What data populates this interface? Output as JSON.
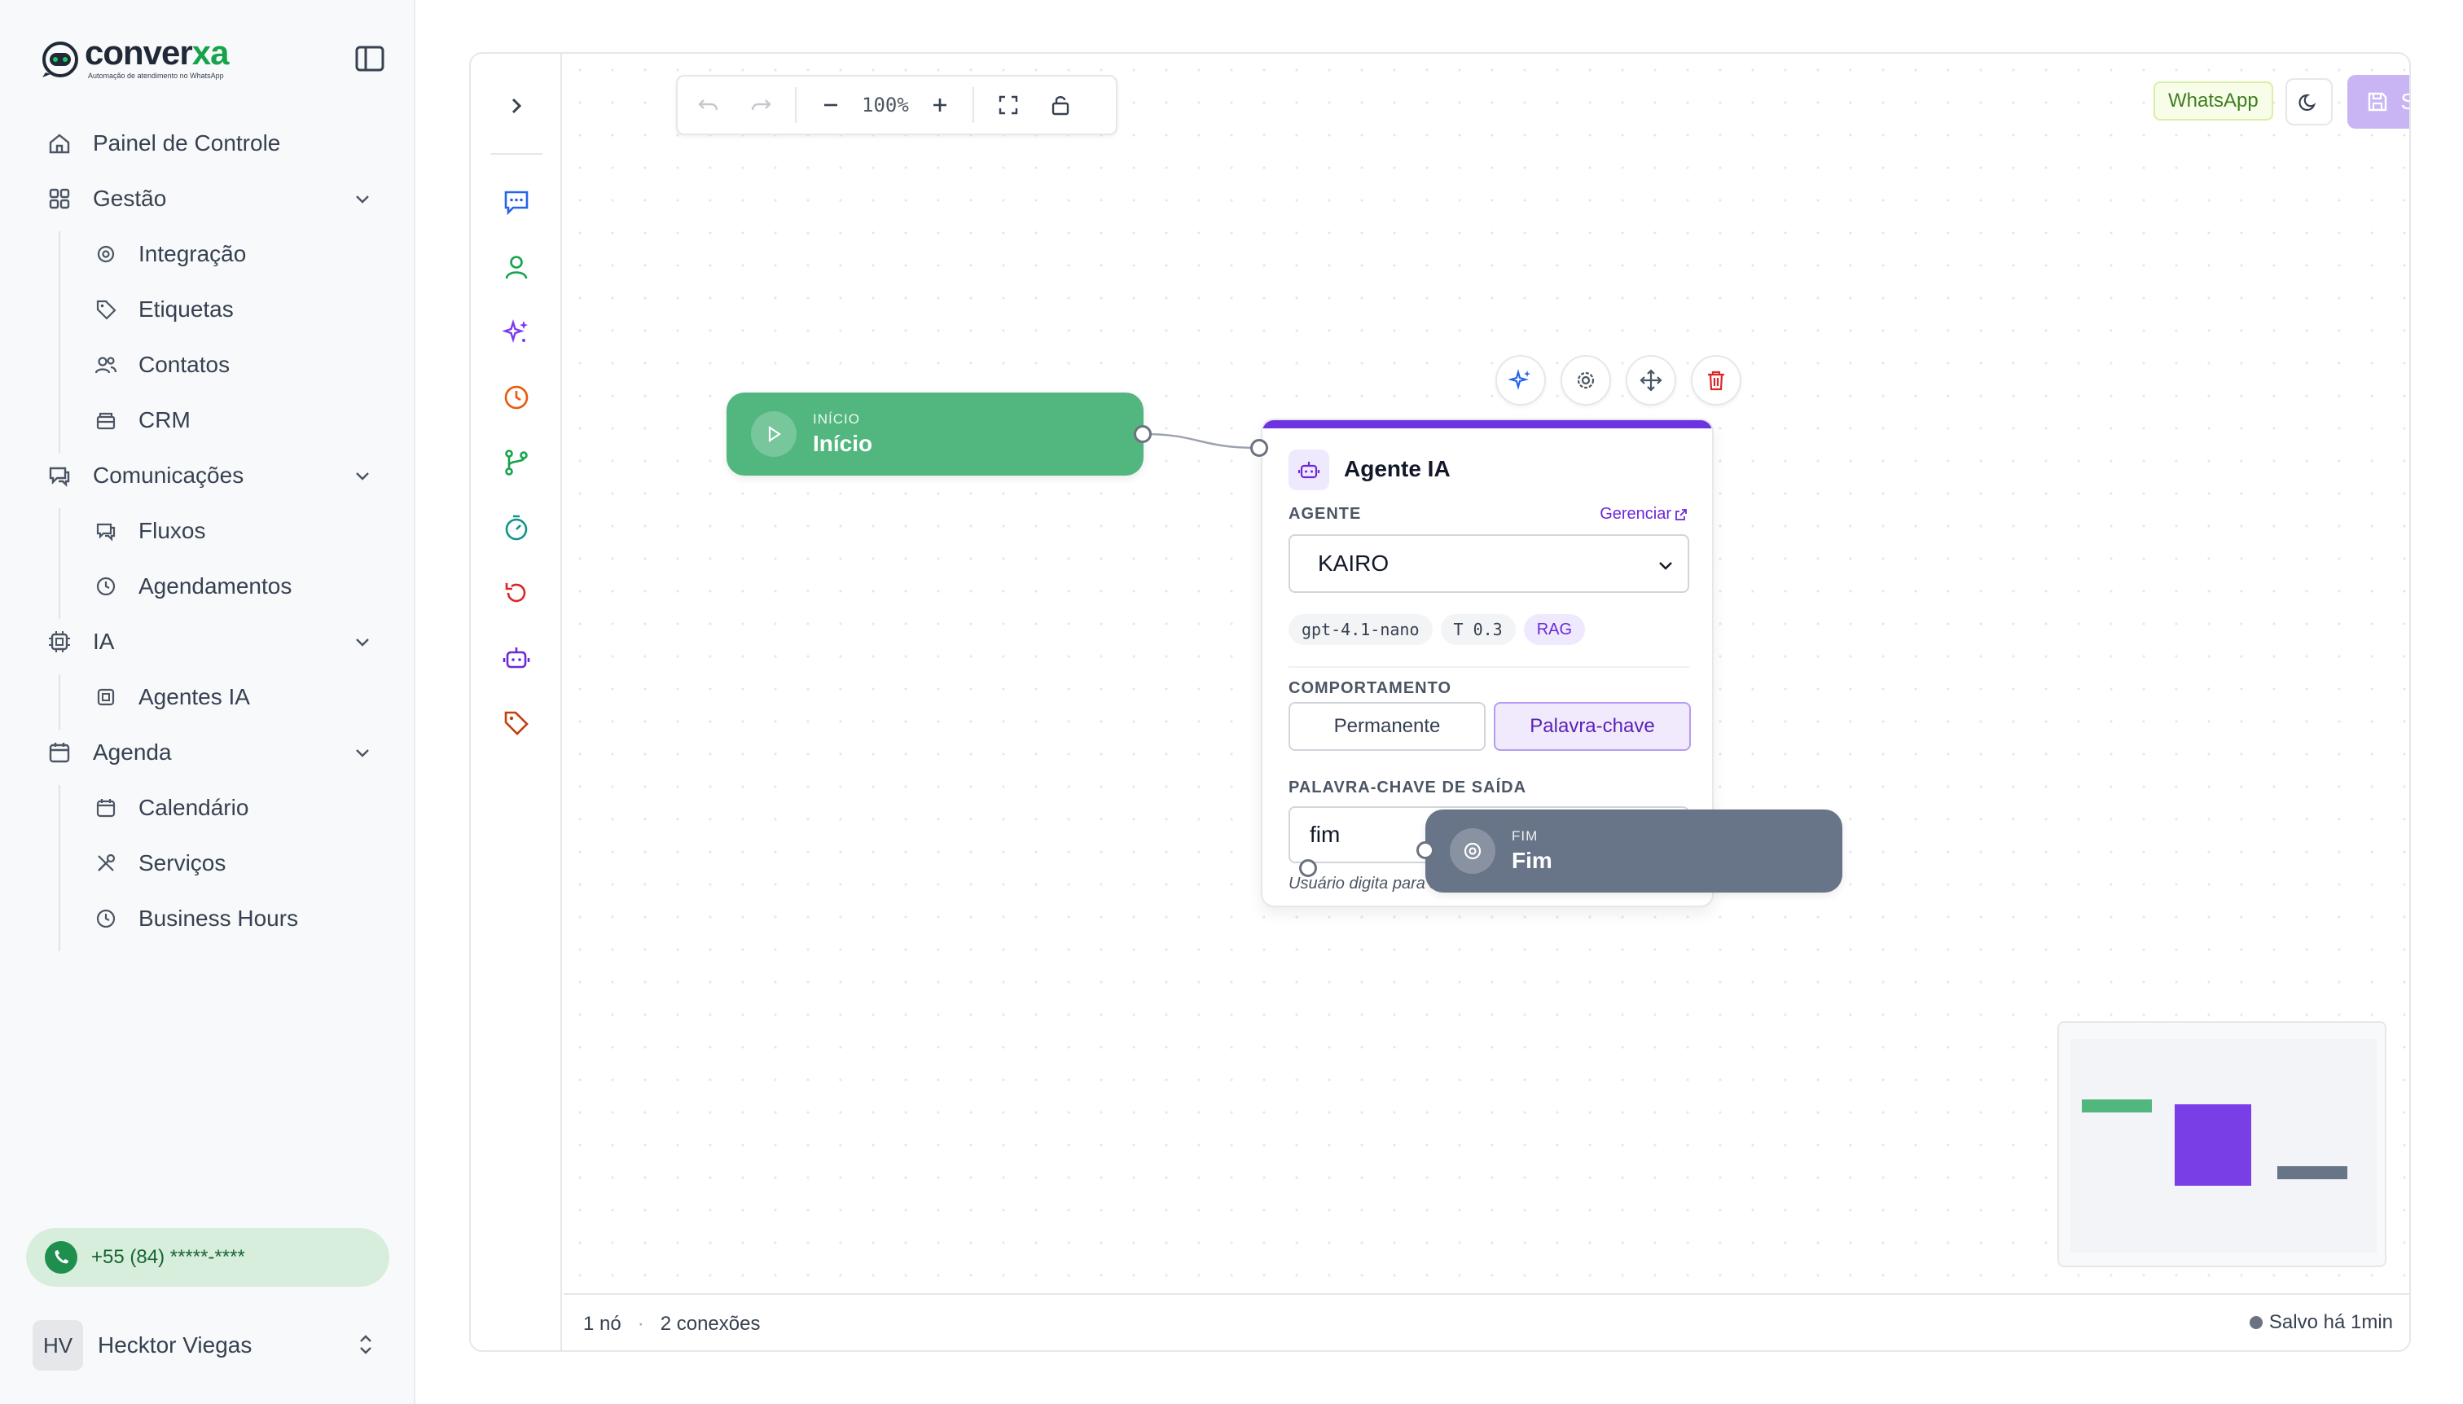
{
  "brand": {
    "name_prefix": "conver",
    "name_accent": "xa",
    "tagline": "Automação de atendimento no WhatsApp"
  },
  "sidebar": {
    "items": [
      {
        "label": "Painel de Controle",
        "icon": "home-icon"
      },
      {
        "label": "Gestão",
        "icon": "grid-icon",
        "expanded": true,
        "children": [
          {
            "label": "Integração",
            "icon": "gear-icon"
          },
          {
            "label": "Etiquetas",
            "icon": "tag-icon"
          },
          {
            "label": "Contatos",
            "icon": "users-icon"
          },
          {
            "label": "CRM",
            "icon": "layers-icon"
          }
        ]
      },
      {
        "label": "Comunicações",
        "icon": "chat-icon",
        "expanded": true,
        "children": [
          {
            "label": "Fluxos",
            "icon": "chat-icon"
          },
          {
            "label": "Agendamentos",
            "icon": "clock-icon"
          }
        ]
      },
      {
        "label": "IA",
        "icon": "chip-icon",
        "expanded": true,
        "children": [
          {
            "label": "Agentes IA",
            "icon": "chip-icon"
          }
        ]
      },
      {
        "label": "Agenda",
        "icon": "calendar-icon",
        "expanded": true,
        "children": [
          {
            "label": "Calendário",
            "icon": "calendar-icon"
          },
          {
            "label": "Serviços",
            "icon": "tools-icon"
          },
          {
            "label": "Business Hours",
            "icon": "clock-icon"
          }
        ]
      }
    ],
    "whatsapp_number": "+55 (84) *****-****",
    "user": {
      "initials": "HV",
      "name": "Hecktor Viegas"
    }
  },
  "toolbar": {
    "zoom": "100%",
    "channel_badge": "WhatsApp",
    "save_label": "Salvar"
  },
  "nodes": {
    "start": {
      "kicker": "INÍCIO",
      "title": "Início"
    },
    "end": {
      "kicker": "FIM",
      "title": "Fim"
    },
    "agent": {
      "title": "Agente IA",
      "agent_label": "AGENTE",
      "manage_label": "Gerenciar",
      "selected_agent": "KAIRO",
      "chips": [
        "gpt-4.1-nano",
        "T 0.3",
        "RAG"
      ],
      "behavior_label": "COMPORTAMENTO",
      "behavior_options": [
        "Permanente",
        "Palavra-chave"
      ],
      "behavior_selected": "Palavra-chave",
      "exit_keyword_label": "PALAVRA-CHAVE DE SAÍDA",
      "exit_keyword_value": "fim",
      "exit_keyword_helper": "Usuário digita para sair do agente"
    }
  },
  "status": {
    "nodes": "1 nó",
    "connections": "2 conexões",
    "saved": "Salvo há 1min"
  },
  "colors": {
    "start_node": "#52b67f",
    "end_node": "#687487",
    "agent_accent": "#6d33e0",
    "save_button": "#c9b5f4"
  }
}
